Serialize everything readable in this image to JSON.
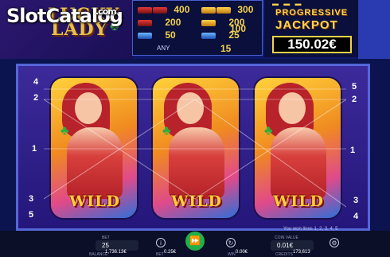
{
  "watermark": {
    "brand_a": "Slot",
    "brand_b": "Catalog",
    "suffix": ".com"
  },
  "game_logo": {
    "line1": "LUCKY",
    "line2": "LADY"
  },
  "paytable": [
    {
      "left_value": "400",
      "right_value": "300"
    },
    {
      "left_value": "200",
      "right_value": "200"
    },
    {
      "left_value": "50",
      "right_value": "25"
    }
  ],
  "paytable_extra": {
    "mid_value": "100",
    "any_label": "ANY",
    "any_value": "15"
  },
  "jackpot": {
    "line1": "PROGRESSIVE",
    "line2": "JACKPOT",
    "value": "150.02€"
  },
  "reels": [
    {
      "symbol": "WILD"
    },
    {
      "symbol": "WILD"
    },
    {
      "symbol": "WILD"
    }
  ],
  "paylines_left": [
    "4",
    "2",
    "1",
    "3",
    "5"
  ],
  "paylines_right": [
    "5",
    "2",
    "1",
    "3",
    "4"
  ],
  "win_lines_text": "You won lines 1, 2, 3, 4, 5",
  "bottom_bar": {
    "lines_label": "BET",
    "lines_value": "25",
    "coin_label": "COIN VALUE",
    "coin_value": "0.01€",
    "balance_label": "BALANCE",
    "balance_value": "1,736.13€",
    "bet_label": "BET",
    "bet_value": "0.25€",
    "win_label": "WIN",
    "win_value": "0.00€",
    "credits_label": "CREDITS",
    "credits_value": "173,613"
  }
}
